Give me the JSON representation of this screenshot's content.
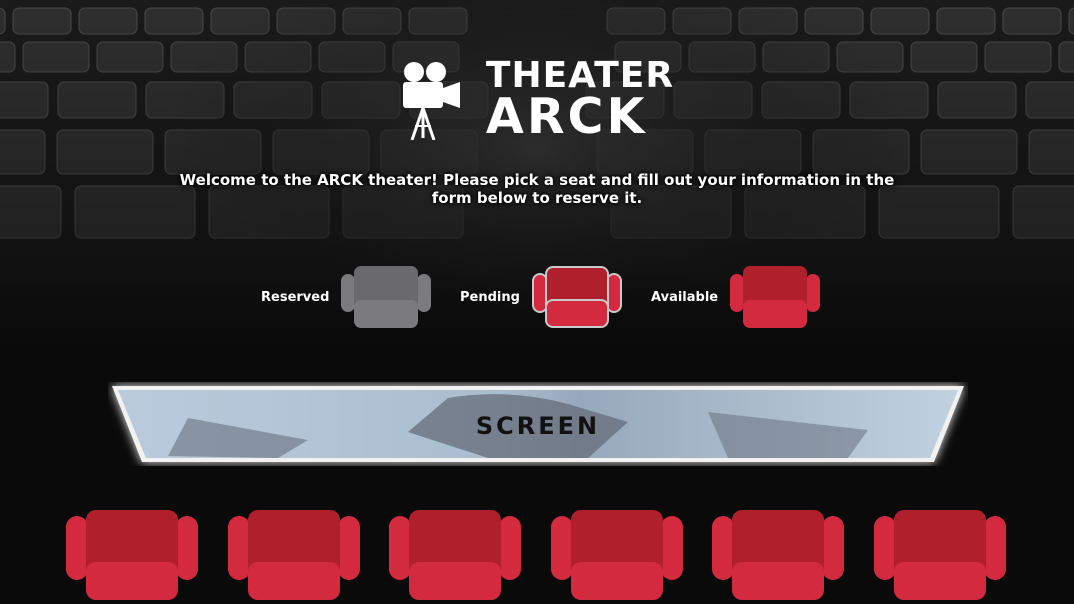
{
  "header": {
    "logo_line1": "THEATER",
    "logo_line2": "ARCK"
  },
  "welcome_text": "Welcome to the ARCK theater! Please pick a seat and fill out your information in the form below to reserve it.",
  "legend": {
    "reserved_label": "Reserved",
    "pending_label": "Pending",
    "available_label": "Available"
  },
  "screen": {
    "label": "SCREEN"
  },
  "seats": [
    {
      "status": "available"
    },
    {
      "status": "available"
    },
    {
      "status": "available"
    },
    {
      "status": "available"
    },
    {
      "status": "available"
    },
    {
      "status": "available"
    }
  ],
  "colors": {
    "seat_available": "#d32a3f",
    "seat_available_dark": "#b0202c",
    "seat_reserved": "#7b7b7d",
    "seat_reserved_dark": "#6a6a6c",
    "seat_pending_border": "#c9c9c9",
    "background": "#0a0a0a"
  }
}
